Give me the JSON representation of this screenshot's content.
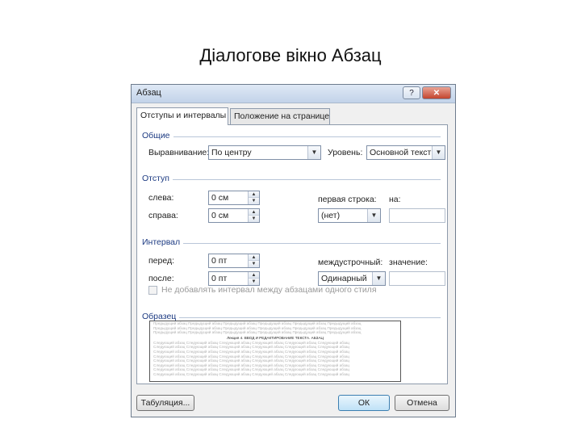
{
  "slide_title": "Діалогове вікно Абзац",
  "dialog": {
    "title": "Абзац",
    "help_button": "?",
    "close_button": "✕",
    "tabs": [
      {
        "label": "Отступы и интервалы",
        "active": true
      },
      {
        "label": "Положение на странице",
        "active": false
      }
    ],
    "general": {
      "section_title": "Общие",
      "alignment_label": "Выравнивание:",
      "alignment_value": "По центру",
      "level_label": "Уровень:",
      "level_value": "Основной текст"
    },
    "indent": {
      "section_title": "Отступ",
      "left_label": "слева:",
      "left_value": "0 см",
      "right_label": "справа:",
      "right_value": "0 см",
      "first_line_label": "первая строка:",
      "first_line_value": "(нет)",
      "by_label": "на:"
    },
    "spacing": {
      "section_title": "Интервал",
      "before_label": "перед:",
      "before_value": "0 пт",
      "after_label": "после:",
      "after_value": "0 пт",
      "line_spacing_label": "междустрочный:",
      "line_spacing_value": "Одинарный",
      "value_label": "значение:",
      "no_space_checkbox_label": "Не добавлять интервал между абзацами одного стиля"
    },
    "preview": {
      "section_title": "Образец",
      "sample_line": "Предыдущий абзац Предыдущий абзац Предыдущий абзац Предыдущий абзац Предыдущий абзац Предыдущий абзац",
      "center_text": "Лекция 4. ВВОД И РЕДАКТИРОВАНИЕ ТЕКСТА. АБЗАЦ",
      "following_line": "Следующий абзац Следующий абзац Следующий абзац Следующий абзац Следующий абзац Следующий абзац"
    },
    "buttons": {
      "tabs": "Табуляция...",
      "ok": "ОК",
      "cancel": "Отмена"
    }
  }
}
